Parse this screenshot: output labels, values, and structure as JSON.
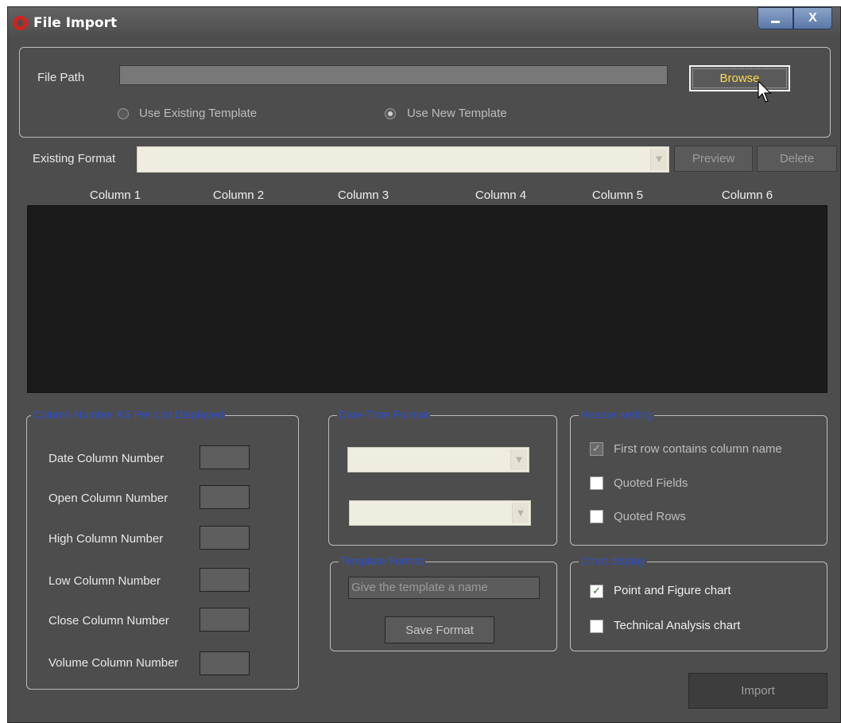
{
  "window": {
    "title": "File Import",
    "minimize_label": "_",
    "close_label": "X"
  },
  "file": {
    "path_label": "File Path",
    "path_value": "",
    "browse_label": "Browse",
    "radio_existing": "Use Existing Template",
    "radio_new": "Use New Template",
    "selected_template_mode": "new"
  },
  "format": {
    "existing_label": "Existing Format",
    "existing_value": "",
    "preview_label": "Preview",
    "delete_label": "Delete"
  },
  "grid": {
    "columns": [
      "Column 1",
      "Column 2",
      "Column 3",
      "Column 4",
      "Column 5",
      "Column 6"
    ]
  },
  "column_numbers": {
    "legend": "Column Number AS Per List Displayed",
    "items": [
      {
        "label": "Date Column Number",
        "value": ""
      },
      {
        "label": "Open Column Number",
        "value": ""
      },
      {
        "label": "High Column Number",
        "value": ""
      },
      {
        "label": "Low Column Number",
        "value": ""
      },
      {
        "label": "Close Column Number",
        "value": ""
      },
      {
        "label": "Volume Column Number",
        "value": ""
      }
    ]
  },
  "datetime": {
    "legend": "Date-Time Format",
    "date_value": "",
    "time_value": ""
  },
  "template": {
    "legend": "Template Format",
    "name_placeholder": "Give the template a name",
    "save_label": "Save Format"
  },
  "header_setting": {
    "legend": "Header setting",
    "first_row": {
      "label": "First row contains column name",
      "checked": true
    },
    "quoted_fields": {
      "label": "Quoted Fields",
      "checked": false
    },
    "quoted_rows": {
      "label": "Quoted Rows",
      "checked": false
    }
  },
  "chart_display": {
    "legend": "Chart display",
    "point_figure": {
      "label": "Point and Figure chart",
      "checked": true
    },
    "technical": {
      "label": "Technical Analysis chart",
      "checked": false
    }
  },
  "import_label": "Import",
  "colors": {
    "window_bg": "#4d4d4d",
    "legend_blue": "#2e4fd0",
    "browse_text": "#ffd94a",
    "grid_bg": "#1b1b1b",
    "combo_bg": "#efece0"
  }
}
